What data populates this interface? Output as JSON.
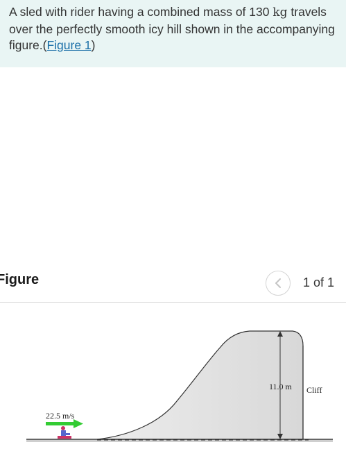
{
  "problem": {
    "text_before": "A sled with rider having a combined mass of 130 ",
    "mass_unit": "kg",
    "text_after": " travels over the perfectly smooth icy hill shown in the accompanying figure.(",
    "figure_link": "Figure 1",
    "text_end": ")"
  },
  "figure_panel": {
    "title": "Figure",
    "page_indicator": "1 of 1",
    "prev_icon": "chevron-left-icon"
  },
  "figure": {
    "speed_label": "22.5 m/s",
    "height_label": "11.0 m",
    "cliff_label": "Cliff",
    "colors": {
      "arrow": "#33cc33",
      "hill_fill": "#e2e2e2",
      "sled": "#cc3366",
      "rider": "#5566cc"
    }
  }
}
